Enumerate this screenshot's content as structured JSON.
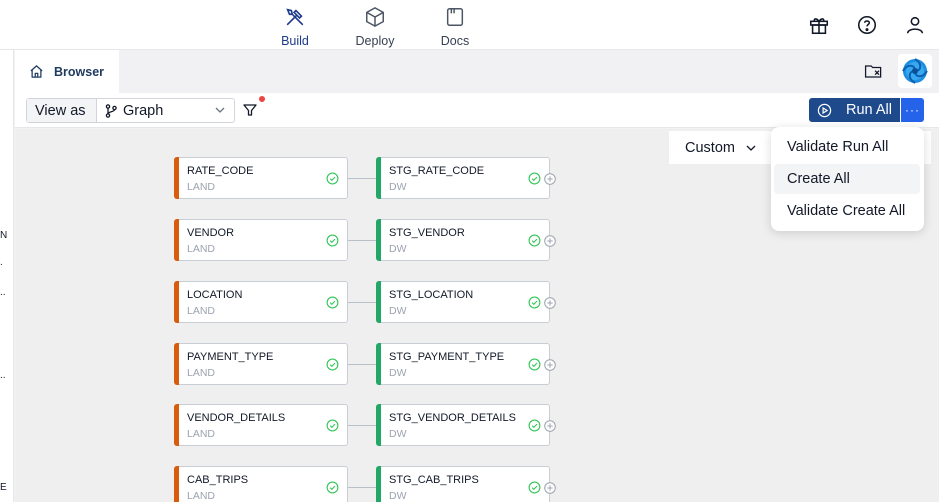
{
  "nav": [
    {
      "label": "Build",
      "icon": "build-tools-icon",
      "active": true
    },
    {
      "label": "Deploy",
      "icon": "deploy-box-icon",
      "active": false
    },
    {
      "label": "Docs",
      "icon": "docs-icon",
      "active": false
    }
  ],
  "header_icons": [
    "gift-icon",
    "help-icon",
    "user-icon"
  ],
  "tab": {
    "label": "Browser"
  },
  "left_strip_chars": [
    "N",
    ".",
    "..",
    "..",
    "E"
  ],
  "toolbar": {
    "view_as_label": "View as",
    "view_value": "Graph",
    "run_all_label": "Run All",
    "more_label": "···"
  },
  "custom_label": "Custom",
  "menu": {
    "items": [
      "Validate Run All",
      "Create All",
      "Validate Create All"
    ],
    "highlighted": "Create All"
  },
  "nodes": [
    {
      "source": "RATE_CODE",
      "source_type": "LAND",
      "target": "STG_RATE_CODE",
      "target_type": "DW"
    },
    {
      "source": "VENDOR",
      "source_type": "LAND",
      "target": "STG_VENDOR",
      "target_type": "DW"
    },
    {
      "source": "LOCATION",
      "source_type": "LAND",
      "target": "STG_LOCATION",
      "target_type": "DW"
    },
    {
      "source": "PAYMENT_TYPE",
      "source_type": "LAND",
      "target": "STG_PAYMENT_TYPE",
      "target_type": "DW"
    },
    {
      "source": "VENDOR_DETAILS",
      "source_type": "LAND",
      "target": "STG_VENDOR_DETAILS",
      "target_type": "DW"
    },
    {
      "source": "CAB_TRIPS",
      "source_type": "LAND",
      "target": "STG_CAB_TRIPS",
      "target_type": "DW"
    }
  ],
  "colors": {
    "land_bar": "#d95b0c",
    "dw_bar": "#22a866",
    "check": "#34c759",
    "run_all_bg": "#1e4a8c",
    "run_more_bg": "#2563eb",
    "notification_dot": "#ef4444"
  }
}
